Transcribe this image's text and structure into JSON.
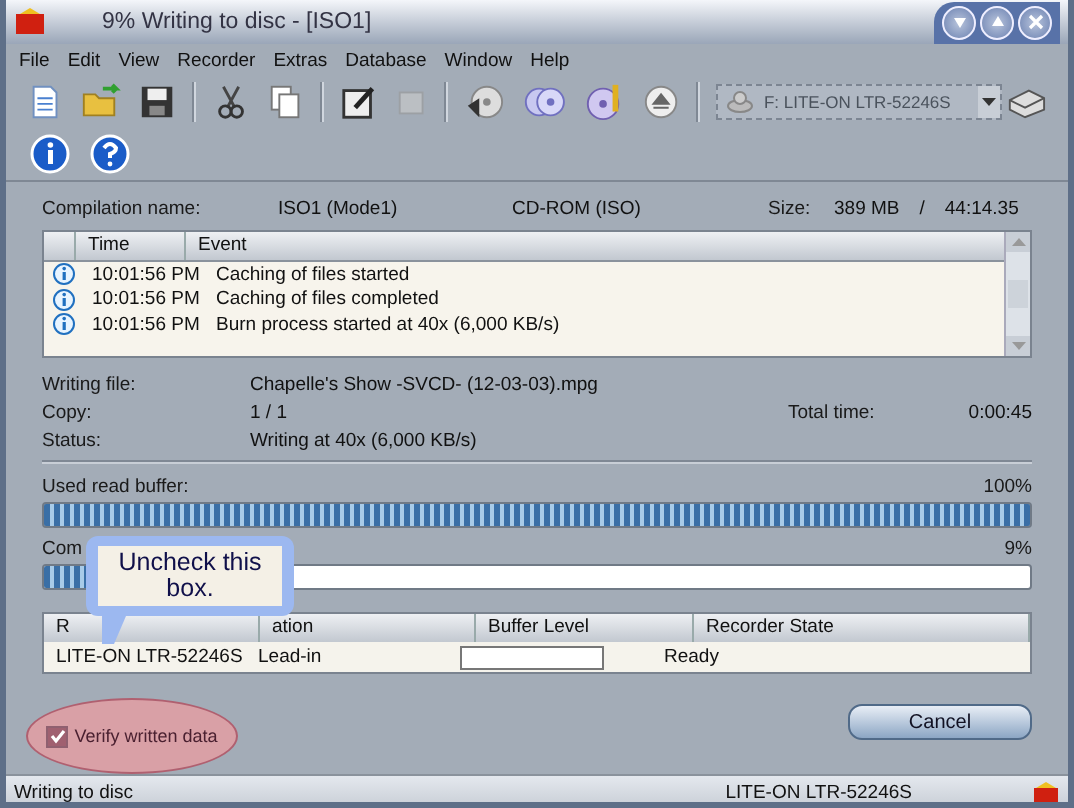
{
  "window": {
    "title": "9% Writing to disc - [ISO1]"
  },
  "menu": [
    "File",
    "Edit",
    "View",
    "Recorder",
    "Extras",
    "Database",
    "Window",
    "Help"
  ],
  "drive_select": {
    "value": "F: LITE-ON  LTR-52246S",
    "disabled": true
  },
  "compilation": {
    "label": "Compilation name:",
    "name": "ISO1 (Mode1)",
    "type": "CD-ROM (ISO)",
    "size_label": "Size:",
    "size": "389 MB",
    "sep": "/",
    "length": "44:14.35"
  },
  "log": {
    "columns": [
      "Time",
      "Event"
    ],
    "rows": [
      {
        "time": "10:01:56 PM",
        "event": "Caching of files started"
      },
      {
        "time": "10:01:56 PM",
        "event": "Caching of files completed"
      },
      {
        "time": "10:01:56 PM",
        "event": "Burn process started at 40x (6,000 KB/s)"
      }
    ]
  },
  "info": [
    {
      "label": "Writing file:",
      "value": "Chapelle's Show -SVCD- (12-03-03).mpg"
    },
    {
      "label": "Copy:",
      "value": "1 / 1",
      "extra_label": "Total time:",
      "extra_value": "0:00:45"
    },
    {
      "label": "Status:",
      "value": "Writing at 40x (6,000 KB/s)"
    }
  ],
  "progress": [
    {
      "label": "Used read buffer:",
      "reading": "100%",
      "level": 1.0
    },
    {
      "label": "Com",
      "reading": "9%",
      "level": 0.09
    }
  ],
  "drives": {
    "columns": [
      "R",
      "ation",
      "Buffer Level",
      "Recorder State"
    ],
    "rows": [
      {
        "recorder": "LITE-ON LTR-52246S",
        "action": "Lead-in",
        "state": "Ready"
      }
    ]
  },
  "verify": {
    "label": "Verify written data",
    "checked": true
  },
  "callout": {
    "text": "Uncheck this box."
  },
  "cancel": "Cancel",
  "status_bar": {
    "left": "Writing to disc",
    "right": "LITE-ON  LTR-52246S"
  }
}
